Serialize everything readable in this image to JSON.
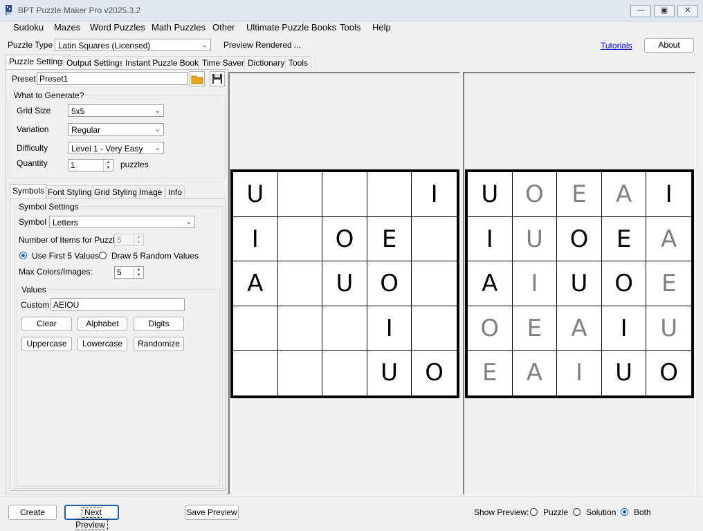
{
  "window": {
    "title": "BPT Puzzle Maker Pro v2025.3.2",
    "controls": [
      "minimize",
      "maximize",
      "close"
    ]
  },
  "menu": [
    "Sudoku",
    "Mazes",
    "Word Puzzles",
    "Math Puzzles",
    "Other",
    "Ultimate Puzzle Books",
    "Tools",
    "Help"
  ],
  "top": {
    "puzzle_type_label": "Puzzle Type",
    "puzzle_type_value": "Latin Squares (Licensed)",
    "status": "Preview Rendered ...",
    "tutorials": "Tutorials",
    "about": "About"
  },
  "tabs": [
    "Puzzle Settings",
    "Output Settings",
    "Instant Puzzle Books",
    "Time Saver",
    "Dictionary",
    "Tools"
  ],
  "preset": {
    "label": "Preset",
    "value": "Preset1"
  },
  "generate": {
    "title": "What to Generate?",
    "grid_size_label": "Grid Size",
    "grid_size": "5x5",
    "variation_label": "Variation",
    "variation": "Regular",
    "difficulty_label": "Difficulty",
    "difficulty": "Level 1 - Very Easy",
    "quantity_label": "Quantity",
    "quantity": "1",
    "quantity_unit": "puzzles"
  },
  "subtabs": [
    "Symbols",
    "Font Styling",
    "Grid Styling",
    "Image",
    "Info"
  ],
  "symbols": {
    "title": "Symbol Settings",
    "symbol_label": "Symbol",
    "symbol": "Letters",
    "items_label": "Number of Items for Puzzle:",
    "items": "5",
    "radio_first": "Use First 5 Values",
    "radio_random": "Draw 5 Random Values",
    "max_label": "Max Colors/Images:",
    "max": "5",
    "values_title": "Values",
    "custom_label": "Custom",
    "custom": "AEIOU",
    "buttons": [
      "Clear",
      "Alphabet",
      "Digits",
      "Uppercase",
      "Lowercase",
      "Randomize"
    ]
  },
  "puzzle": [
    [
      "U",
      "",
      "",
      "",
      "I"
    ],
    [
      "I",
      "",
      "O",
      "E",
      ""
    ],
    [
      "A",
      "",
      "U",
      "O",
      ""
    ],
    [
      "",
      "",
      "",
      "I",
      ""
    ],
    [
      "",
      "",
      "",
      "U",
      "O"
    ]
  ],
  "solution": [
    [
      "U",
      "O",
      "E",
      "A",
      "I"
    ],
    [
      "I",
      "U",
      "O",
      "E",
      "A"
    ],
    [
      "A",
      "I",
      "U",
      "O",
      "E"
    ],
    [
      "O",
      "E",
      "A",
      "I",
      "U"
    ],
    [
      "E",
      "A",
      "I",
      "U",
      "O"
    ]
  ],
  "bottom": {
    "create": "Create",
    "next_preview": "Next Preview",
    "save_preview": "Save Preview",
    "show_preview_label": "Show Preview:",
    "opt_puzzle": "Puzzle",
    "opt_solution": "Solution",
    "opt_both": "Both"
  },
  "colors": {
    "given": "#000000",
    "solution_fill": "#808080",
    "accent": "#1a5fb4"
  }
}
